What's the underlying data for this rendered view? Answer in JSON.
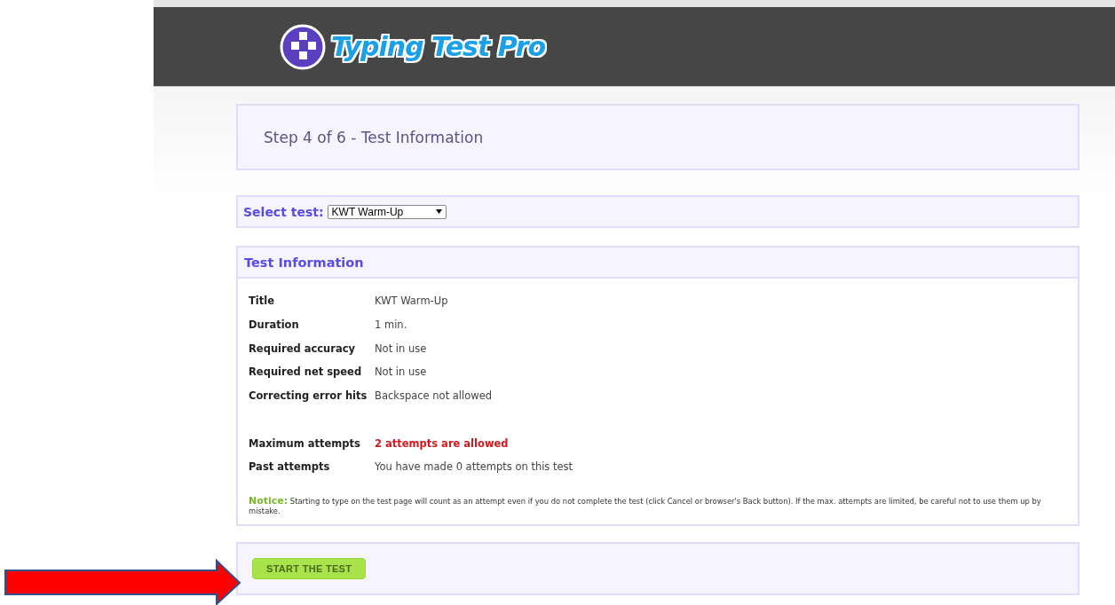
{
  "header": {
    "logo_text": "Typing Test Pro"
  },
  "step": {
    "title": "Step 4 of 6 - Test Information"
  },
  "select_test": {
    "label": "Select test:",
    "value": "KWT Warm-Up"
  },
  "test_information": {
    "heading": "Test Information",
    "groups": [
      [
        {
          "label": "Title",
          "value": "KWT Warm-Up",
          "emphasis": false
        },
        {
          "label": "Duration",
          "value": "1 min.",
          "emphasis": false
        },
        {
          "label": "Required accuracy",
          "value": "Not in use",
          "emphasis": false
        },
        {
          "label": "Required net speed",
          "value": "Not in use",
          "emphasis": false
        },
        {
          "label": "Correcting error hits",
          "value": "Backspace not allowed",
          "emphasis": false
        }
      ],
      [
        {
          "label": "Maximum attempts",
          "value": "2 attempts are allowed",
          "emphasis": true
        },
        {
          "label": "Past attempts",
          "value": "You have made 0 attempts on this test",
          "emphasis": false
        }
      ]
    ],
    "notice": {
      "label": "Notice:",
      "text": "Starting to type on the test page will count as an attempt even if you do not complete the test (click Cancel or browser's Back button). If the max. attempts are limited, be careful not to use them up by mistake."
    }
  },
  "start_button": {
    "label": "START THE TEST"
  }
}
